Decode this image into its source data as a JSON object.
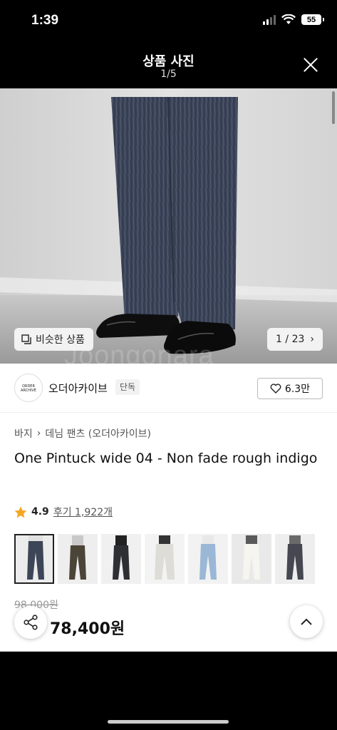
{
  "status": {
    "time": "1:39",
    "battery": "55"
  },
  "header": {
    "title": "상품 사진",
    "page": "1/5"
  },
  "photo": {
    "similar_label": "비슷한 상품",
    "counter": "1 / 23",
    "watermark": "Joongonara"
  },
  "seller": {
    "name": "오더아카이브",
    "badge": "단독",
    "likes": "6.3만",
    "logo_text": "ORDER ARCHIVE"
  },
  "breadcrumb": [
    "바지",
    "데님 팬츠 (오더아카이브)"
  ],
  "product": {
    "title": "One Pintuck wide 04 - Non fade rough indigo",
    "rating": "4.9",
    "reviews": "후기 1,922개",
    "original_price": "98,000원",
    "price": "78,400원"
  },
  "thumbnails": [
    {
      "name": "indigo",
      "color": "#3d4657"
    },
    {
      "name": "brown",
      "color": "#4b4538"
    },
    {
      "name": "black",
      "color": "#2d2f33"
    },
    {
      "name": "white",
      "color": "#e7e6e2"
    },
    {
      "name": "light-blue",
      "color": "#9ab7d6"
    },
    {
      "name": "cream",
      "color": "#ecebe5"
    },
    {
      "name": "charcoal",
      "color": "#454850"
    }
  ]
}
